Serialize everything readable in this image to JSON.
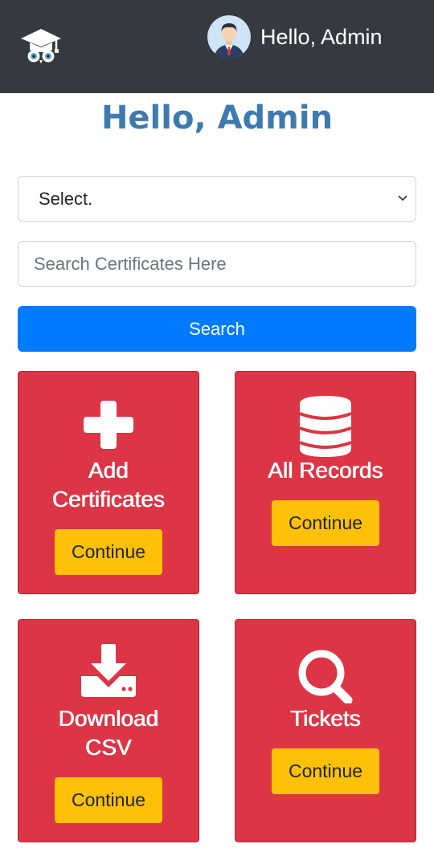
{
  "header": {
    "logo_icon": "graduation-owl-icon",
    "avatar_icon": "user-avatar-icon",
    "greeting": "Hello, Admin"
  },
  "main": {
    "title": "Hello, Admin",
    "select": {
      "value": "Select."
    },
    "search": {
      "placeholder": "Search Certificates Here",
      "button_label": "Search"
    }
  },
  "cards": [
    {
      "icon": "plus-icon",
      "title_lines": [
        "Add",
        "Certificates"
      ],
      "button_label": "Continue"
    },
    {
      "icon": "database-icon",
      "title_lines": [
        "All Records"
      ],
      "button_label": "Continue"
    },
    {
      "icon": "download-icon",
      "title_lines": [
        "Download",
        "CSV"
      ],
      "button_label": "Continue"
    },
    {
      "icon": "search-icon",
      "title_lines": [
        "Tickets"
      ],
      "button_label": "Continue"
    }
  ],
  "colors": {
    "navbar": "#343a40",
    "title": "#3f7aae",
    "primary": "#007bff",
    "card": "#dc3545",
    "card_button": "#ffc107"
  }
}
